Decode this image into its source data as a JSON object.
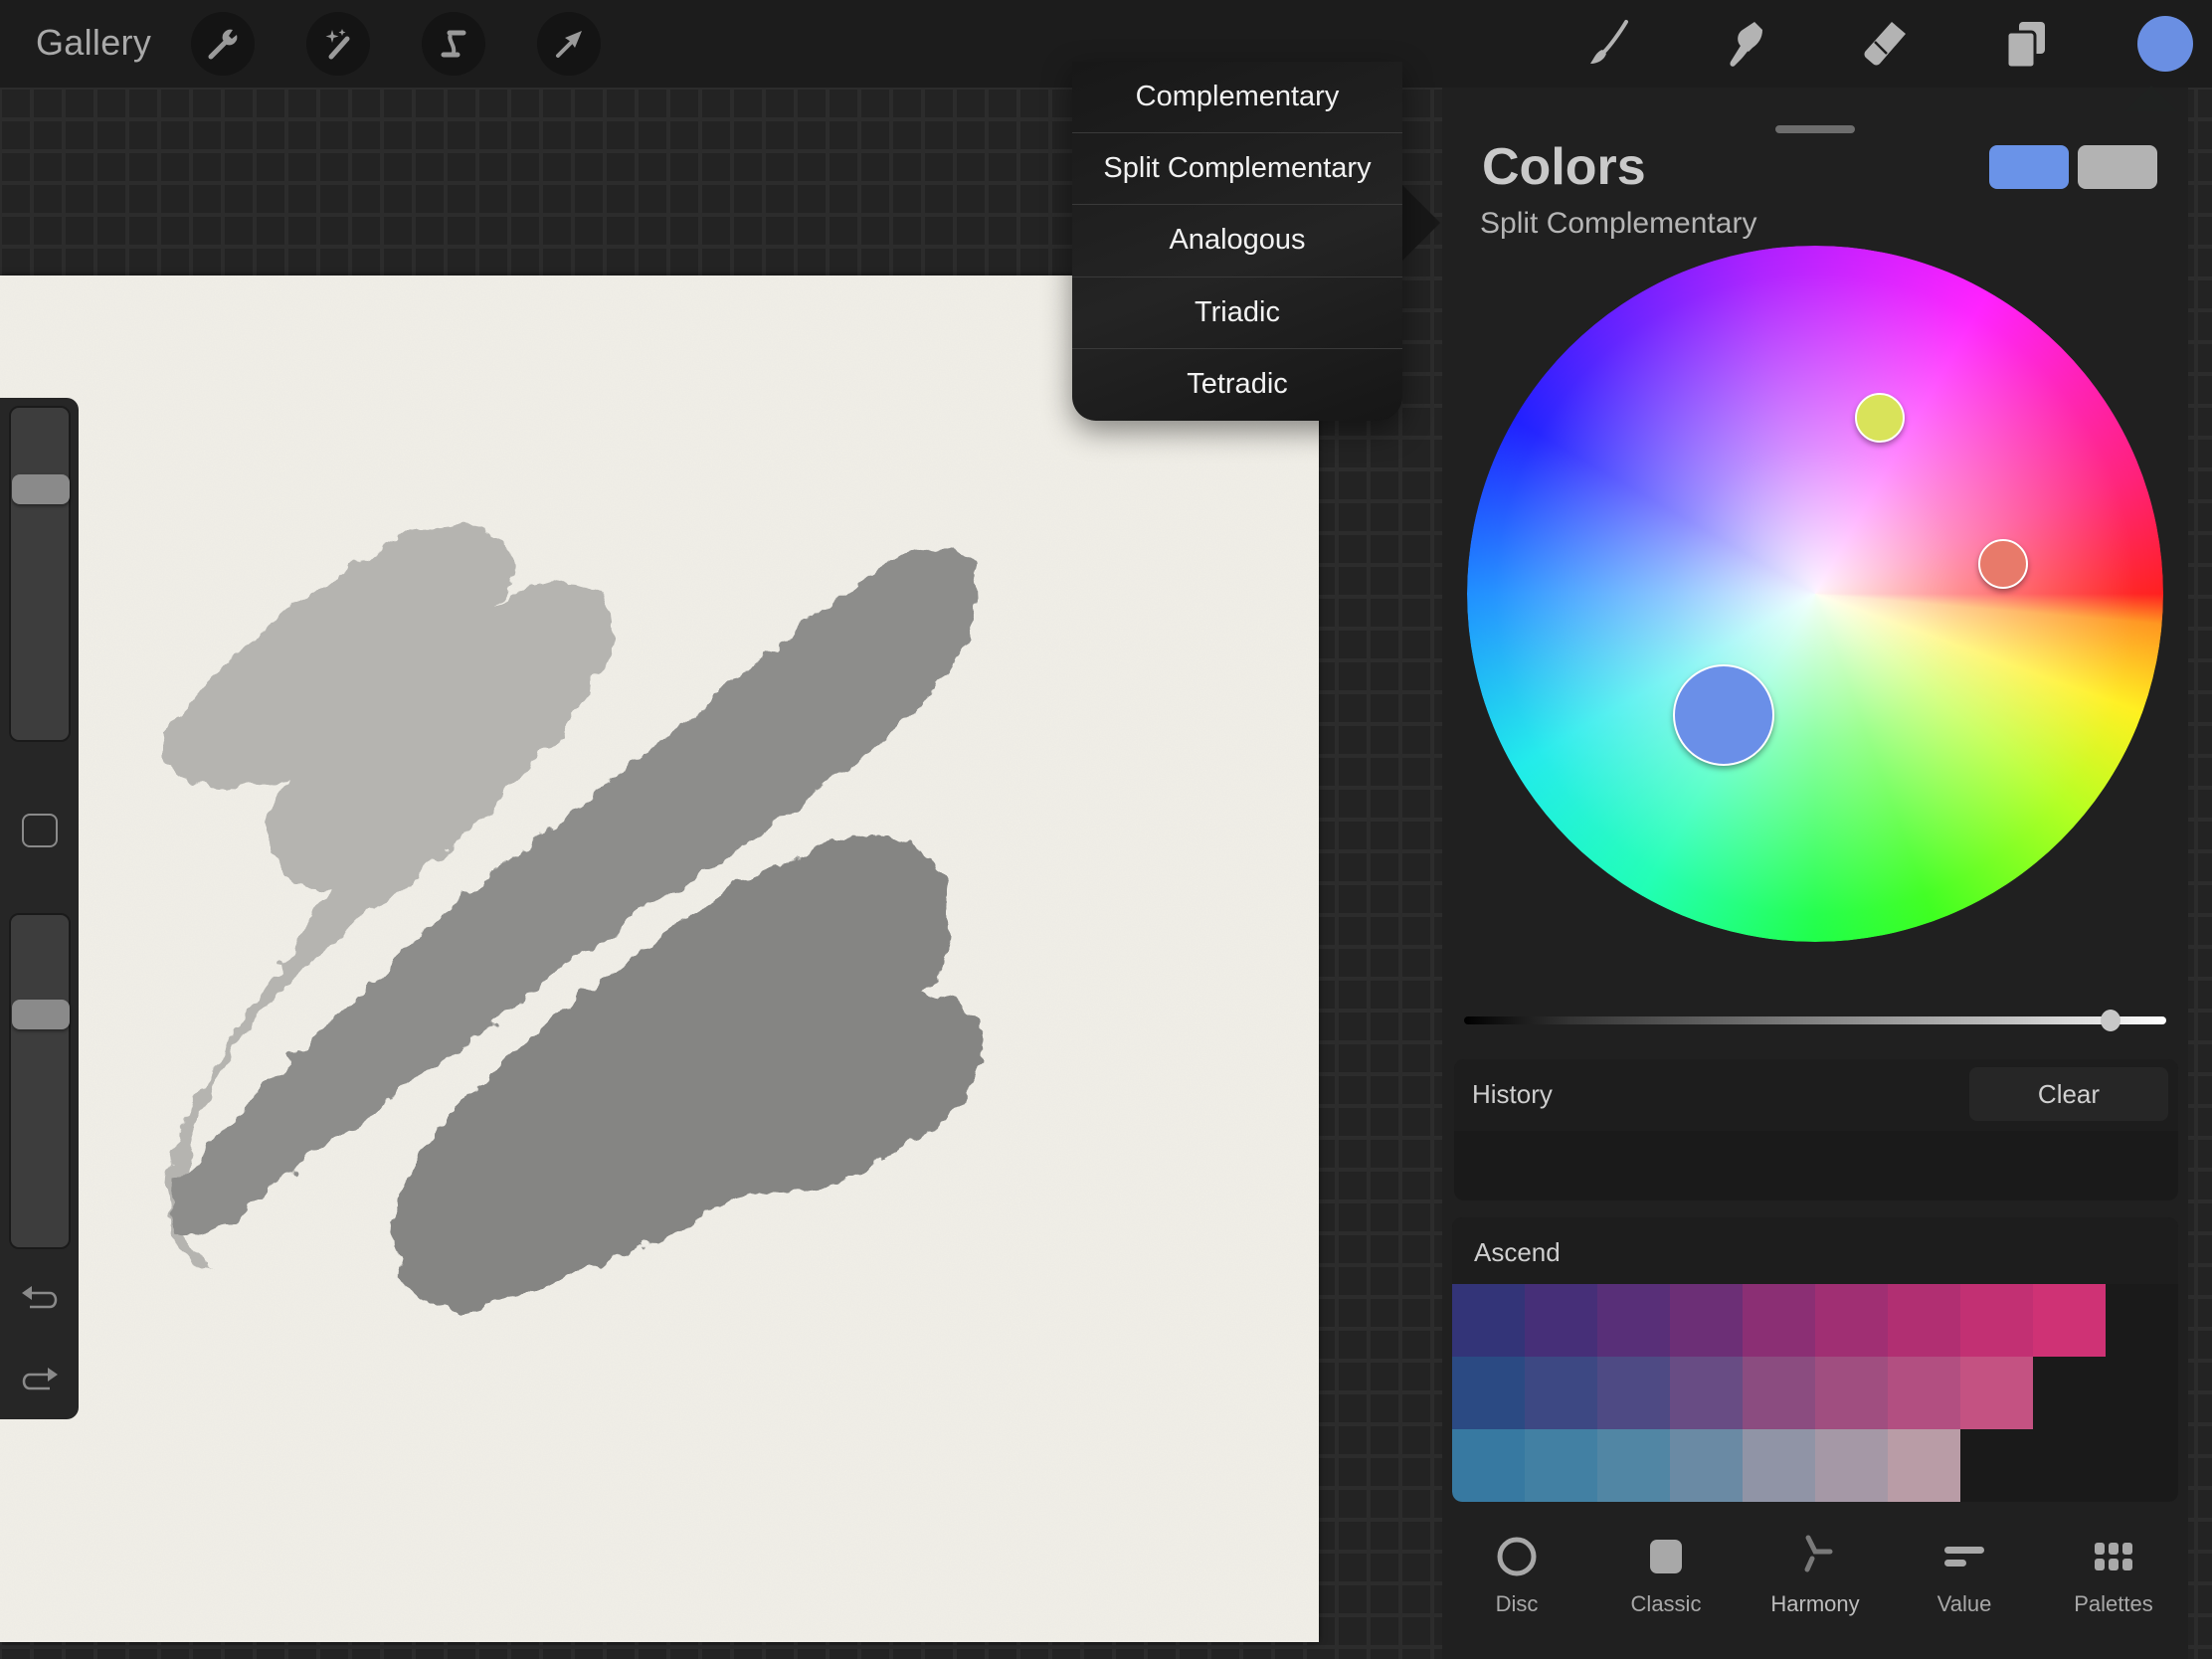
{
  "topbar": {
    "gallery_label": "Gallery",
    "left_tools": [
      {
        "name": "actions",
        "icon": "wrench-icon"
      },
      {
        "name": "adjustments",
        "icon": "magic-wand-icon"
      },
      {
        "name": "selection",
        "icon": "selection-s-icon"
      },
      {
        "name": "transform",
        "icon": "arrow-cursor-icon"
      }
    ],
    "right_tools": [
      {
        "name": "brush",
        "icon": "paintbrush-icon"
      },
      {
        "name": "smudge",
        "icon": "smudge-finger-icon"
      },
      {
        "name": "eraser",
        "icon": "eraser-icon"
      },
      {
        "name": "layers",
        "icon": "layers-icon"
      }
    ],
    "current_color": "#6a8fe3"
  },
  "harmony_menu": {
    "items": [
      "Complementary",
      "Split Complementary",
      "Analogous",
      "Triadic",
      "Tetradic"
    ],
    "selected": "Split Complementary"
  },
  "colors_panel": {
    "title": "Colors",
    "mode": "Split Complementary",
    "primary_color": "#6a93e8",
    "secondary_color": "#b3b3b3",
    "harmony_points": [
      {
        "role": "primary",
        "color": "#6a8fe8"
      },
      {
        "role": "split-1",
        "color": "#d9e35a"
      },
      {
        "role": "split-2",
        "color": "#e87a6a"
      }
    ],
    "brightness_percent": 92,
    "history": {
      "label": "History",
      "clear_label": "Clear"
    },
    "palette": {
      "name": "Ascend",
      "rows": [
        [
          "#333478",
          "#462f78",
          "#582f78",
          "#6c2f76",
          "#8b2f74",
          "#a02f73",
          "#b12f72",
          "#c23073",
          "#cf3275"
        ],
        [
          "#2b4a83",
          "#3d4883",
          "#4e4a84",
          "#684c84",
          "#8b4c80",
          "#a04e80",
          "#b24f81",
          "#c45282"
        ],
        [
          "#3779a1",
          "#4280a3",
          "#5186a4",
          "#6a8aa4",
          "#9094a6",
          "#a598a6",
          "#b99ca6"
        ]
      ]
    },
    "tabs": [
      {
        "label": "Disc",
        "icon": "disc-ring-icon",
        "active": false
      },
      {
        "label": "Classic",
        "icon": "classic-square-icon",
        "active": false
      },
      {
        "label": "Harmony",
        "icon": "harmony-branch-icon",
        "active": true
      },
      {
        "label": "Value",
        "icon": "value-bars-icon",
        "active": false
      },
      {
        "label": "Palettes",
        "icon": "palettes-grid-icon",
        "active": false
      }
    ]
  },
  "sidebar": {
    "brush_size_percent": 78,
    "opacity_percent": 72
  }
}
